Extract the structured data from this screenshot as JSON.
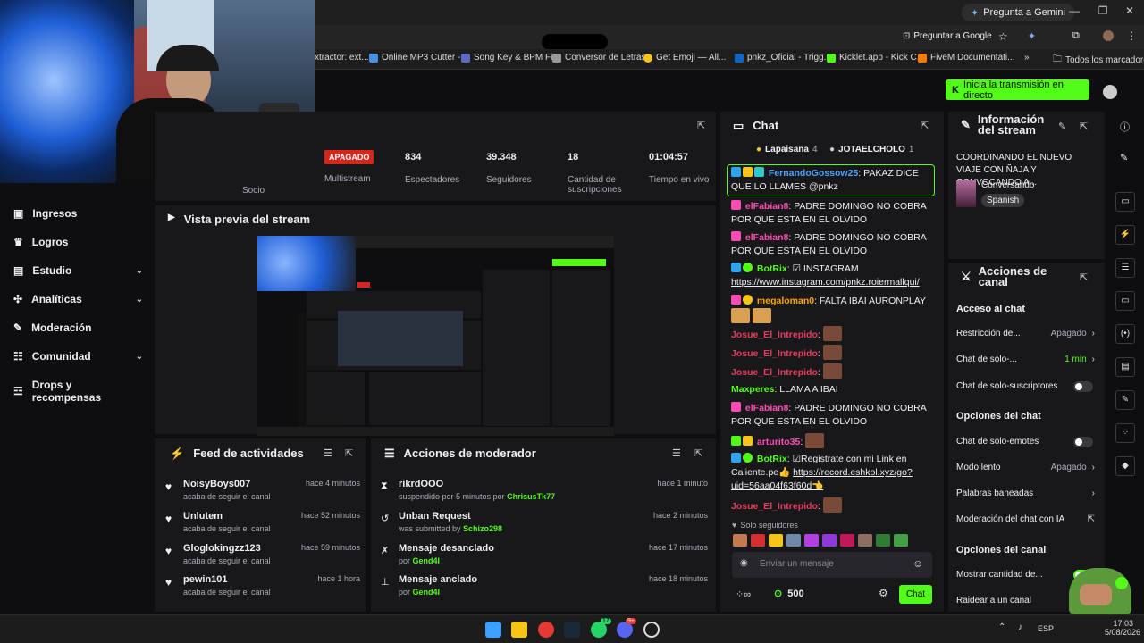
{
  "browser": {
    "gemini_button": "Pregunta a Gemini",
    "ask_google": "Preguntar a Google",
    "bookmarks": [
      {
        "label": "xtractor: ext...",
        "color": "#888888"
      },
      {
        "label": "Online MP3 Cutter -...",
        "color": "#4a90e2"
      },
      {
        "label": "Song Key & BPM Fi...",
        "color": "#5c6bc0"
      },
      {
        "label": "Conversor de Letras...",
        "color": "#999999"
      },
      {
        "label": "Get Emoji — All...",
        "color": "#f5c518"
      },
      {
        "label": "pnkz_Oficial - Trigg...",
        "color": "#1565c0"
      },
      {
        "label": "Kicklet.app - Kick C...",
        "color": "#53fc18"
      },
      {
        "label": "FiveM Documentati...",
        "color": "#f57c00"
      }
    ],
    "all_bookmarks": "Todos los marcadores"
  },
  "header": {
    "go_live": "Inicia la transmisión en directo"
  },
  "sidebar": {
    "partner_label": "Socio",
    "items": [
      {
        "label": "Ingresos",
        "icon": "revenue-icon",
        "chevron": false
      },
      {
        "label": "Logros",
        "icon": "trophy-icon",
        "chevron": false
      },
      {
        "label": "Estudio",
        "icon": "studio-icon",
        "chevron": true
      },
      {
        "label": "Analíticas",
        "icon": "analytics-icon",
        "chevron": true
      },
      {
        "label": "Moderación",
        "icon": "wrench-icon",
        "chevron": false
      },
      {
        "label": "Comunidad",
        "icon": "community-icon",
        "chevron": true
      },
      {
        "label": "Drops y recompensas",
        "icon": "drops-icon",
        "chevron": false
      }
    ]
  },
  "stats": {
    "multistream_badge": "APAGADO",
    "multistream_label": "Multistream",
    "viewers_value": "834",
    "viewers_label": "Espectadores",
    "followers_value": "39.348",
    "followers_label": "Seguidores",
    "subs_value": "18",
    "subs_label": "Cantidad de suscripciones",
    "uptime_value": "01:04:57",
    "uptime_label": "Tiempo en vivo"
  },
  "preview": {
    "title": "Vista previa del stream"
  },
  "activity_feed": {
    "title": "Feed de actividades",
    "items": [
      {
        "name": "NoisyBoys007",
        "sub": "acaba de seguir el canal",
        "time": "hace 4 minutos"
      },
      {
        "name": "Unlutem",
        "sub": "acaba de seguir el canal",
        "time": "hace 52 minutos"
      },
      {
        "name": "Gloglokingzz123",
        "sub": "acaba de seguir el canal",
        "time": "hace 59 minutos"
      },
      {
        "name": "pewin101",
        "sub": "acaba de seguir el canal",
        "time": "hace 1 hora"
      }
    ]
  },
  "mod_actions": {
    "title": "Acciones de moderador",
    "items": [
      {
        "title": "rikrdOOO",
        "sub": "suspendido por 5 minutos por",
        "who": "ChrisusTk77",
        "time": "hace 1 minuto",
        "icon": "hourglass-icon"
      },
      {
        "title": "Unban Request",
        "sub": "was submitted by",
        "who": "Schizo298",
        "time": "hace 2 minutos",
        "icon": "unban-icon"
      },
      {
        "title": "Mensaje desanclado",
        "sub": "por",
        "who": "Gend4l",
        "time": "hace 17 minutos",
        "icon": "unpin-icon"
      },
      {
        "title": "Mensaje anclado",
        "sub": "por",
        "who": "Gend4l",
        "time": "hace 18 minutos",
        "icon": "pin-icon"
      }
    ]
  },
  "chat": {
    "title": "Chat",
    "top1_name": "Lapaisana",
    "top1_count": "4",
    "top2_name": "JOTAELCHOLO",
    "top2_count": "1",
    "pinned_user": "FernandoGossow25",
    "pinned_text": ": PAKAZ DICE QUE LO LLAMES @pnkz",
    "messages": [
      {
        "user": "elFabian8",
        "color": "#ff4bb4",
        "text": ": PADRE DOMINGO NO COBRA POR QUE ESTA EN EL OLVIDO"
      },
      {
        "user": "elFabian8",
        "color": "#ff4bb4",
        "text": ": PADRE DOMINGO NO COBRA POR QUE ESTA EN EL OLVIDO"
      },
      {
        "user": "BotRix",
        "color": "#53fc18",
        "text": ": ☑ INSTAGRAM",
        "link": "https://www.instagram.com/pnkz.roiermallqui/"
      },
      {
        "user": "megaloman0",
        "color": "#ffa500",
        "text": ": FALTA IBAI AURONPLAY"
      },
      {
        "user": "Josue_El_Intrepido",
        "color": "#e83a5c",
        "text": ":"
      },
      {
        "user": "Josue_El_Intrepido",
        "color": "#e83a5c",
        "text": ":"
      },
      {
        "user": "Josue_El_Intrepido",
        "color": "#e83a5c",
        "text": ":"
      },
      {
        "user": "Maxperes",
        "color": "#53fc18",
        "text": ": LLAMA A IBAI"
      },
      {
        "user": "elFabian8",
        "color": "#ff4bb4",
        "text": ": PADRE DOMINGO NO COBRA POR QUE ESTA EN EL OLVIDO"
      },
      {
        "user": "arturito35",
        "color": "#ff4bb4",
        "text": ":"
      },
      {
        "user": "BotRix",
        "color": "#53fc18",
        "text": ": ☑Registrate con mi Link en Caliente.pe👍",
        "link": "https://record.eshkol.xyz/go?uid=56aa04f63f60d👈"
      },
      {
        "user": "Josue_El_Intrepido",
        "color": "#e83a5c",
        "text": ":"
      }
    ],
    "followers_only": "Solo seguidores",
    "input_placeholder": "Enviar un mensaje",
    "points": "500",
    "send": "Chat"
  },
  "stream_info": {
    "title": "Información del stream",
    "stream_title": "COORDINANDO EL NUEVO VIAJE CON ÑAJA Y CONVOCANDO A...",
    "category": "Conversando",
    "language": "Spanish"
  },
  "channel_actions": {
    "title": "Acciones de canal",
    "chat_access": "Acceso al chat",
    "restriction_label": "Restricción de...",
    "restriction_value": "Apagado",
    "solo_chat_label": "Chat de solo-...",
    "solo_chat_value": "1 min",
    "subs_only_label": "Chat de solo-suscriptores",
    "chat_options": "Opciones del chat",
    "emotes_only_label": "Chat de solo-emotes",
    "slow_mode_label": "Modo lento",
    "slow_mode_value": "Apagado",
    "banned_words_label": "Palabras baneadas",
    "ai_mod_label": "Moderación del chat con IA",
    "channel_options": "Opciones del canal",
    "show_count_label": "Mostrar cantidad de...",
    "raid_label": "Raidear a un canal"
  },
  "taskbar": {
    "lang": "ESP",
    "time": "17:03",
    "date": "5/08/2026",
    "badge1": "17",
    "badge2": "9+"
  }
}
